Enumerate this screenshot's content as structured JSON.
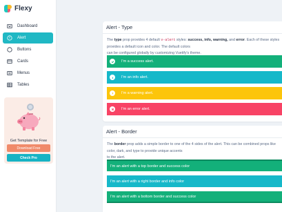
{
  "brand": {
    "name": "Flexy"
  },
  "sidebar": {
    "items": [
      {
        "label": "Dashboard",
        "icon": "dashboard-icon",
        "active": false
      },
      {
        "label": "Alert",
        "icon": "info-circle-icon",
        "active": true
      },
      {
        "label": "Buttons",
        "icon": "circle-icon",
        "active": false
      },
      {
        "label": "Cards",
        "icon": "card-icon",
        "active": false
      },
      {
        "label": "Menus",
        "icon": "menu-icon",
        "active": false
      },
      {
        "label": "Tables",
        "icon": "table-icon",
        "active": false
      }
    ]
  },
  "promo": {
    "title": "Get Template for Free",
    "download_label": "Download Free",
    "pro_label": "Check Pro"
  },
  "type_card": {
    "title": "Alert - Type",
    "desc": {
      "p1": "The ",
      "k1": "type",
      "p2": " prop provides 4 default ",
      "code": "v-alert",
      "p3": " styles: ",
      "k2": "success, info, warning,",
      "p4": " and ",
      "k3": "error",
      "p5": ". Each of these styles provides a default icon and color. The default colors",
      "p6": "can be configured globally by customizing Vuetify's theme."
    },
    "alerts": [
      {
        "kind": "success",
        "text": "I'm a success alert.",
        "icon": "check-circle-icon"
      },
      {
        "kind": "info",
        "text": "I'm an info alert.",
        "icon": "info-circle-icon"
      },
      {
        "kind": "warning",
        "text": "I'm a warning alert.",
        "icon": "warning-icon"
      },
      {
        "kind": "error",
        "text": "I'm an error alert.",
        "icon": "close-circle-icon"
      }
    ]
  },
  "border_card": {
    "title": "Alert - Border",
    "desc": {
      "p1": "The ",
      "k1": "border",
      "p2": " prop adds a simple border to one of the 4 sides of the alert. This can be combined props like color, dark, and type to provide unique accents",
      "p3": "to the alert."
    },
    "alerts": [
      {
        "text": "I'm an alert with a top border and success color"
      },
      {
        "text": "I'm an alert with a right border and info color"
      },
      {
        "text": "I'm an alert with a bottom border and success color"
      }
    ]
  },
  "colors": {
    "accent": "#20b8c4",
    "success": "#13b07a",
    "info": "#16b8c9",
    "warning": "#fcc50b",
    "error": "#f84365"
  }
}
